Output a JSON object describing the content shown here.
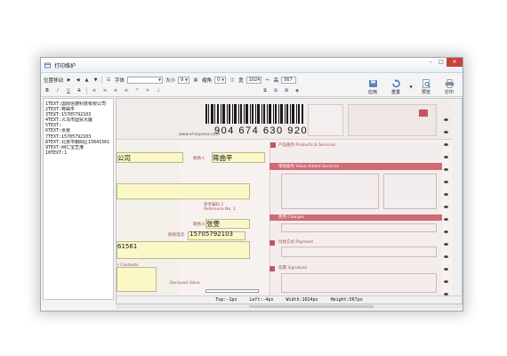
{
  "window": {
    "title": "打印维护"
  },
  "toolbar": {
    "position_label": "位置移动",
    "nav_arrows": [
      "▶",
      "◀",
      "▲",
      "▼"
    ],
    "font_label": "字体",
    "font_value": "",
    "size_label": "大小",
    "size_value": "9",
    "spacing_label": "缩角",
    "spacing_value": "0",
    "width_label": "宽",
    "width_value": "1024",
    "height_label": "高",
    "height_value": "567",
    "format_buttons": [
      "B",
      "I",
      "U",
      "S"
    ],
    "actions": [
      {
        "label": "应用",
        "icon": "apply-icon"
      },
      {
        "label": "重置",
        "icon": "reset-icon"
      },
      {
        "label": "预览",
        "icon": "preview-icon"
      },
      {
        "label": "打印",
        "icon": "print-icon"
      }
    ]
  },
  "fields": [
    "1TEXT:国际信德科技有限公司",
    "2TEXT:蒋曲平",
    "3TEXT:15705792103",
    "4TEXT:义乌市国贸大厦",
    "5TEXT:",
    "6TEXT:张雯",
    "7TEXT:15705792103",
    "8TEXT:北京市朝阳区15641561",
    "9TEXT:网仁宝芝港",
    "10TEXT:1"
  ],
  "waybill": {
    "barcode_number": "904 674 630 920",
    "website": "www.sf-express.com",
    "products_services": "产品服务 Products & Services",
    "value_added": "增值服务 Value Added Services",
    "charges": "费用 Charges",
    "payment": "付款方式 Payment",
    "signature": "签署 Signature",
    "contents": "t Contents",
    "declared_value": "Declared Value",
    "ref_label": "参考编码 2",
    "ref_label_en": "Reference No. 2"
  },
  "overlay": {
    "sender_company": "公司",
    "sender_name": "蒋曲平",
    "receiver_name": "张雯",
    "receiver_phone": "15705792103",
    "postal_code": "61561",
    "contact_label": "联络人",
    "contact_label2": "联络人",
    "phone_label": "联络电话"
  },
  "status": {
    "top": "Top:-1px",
    "left": "Left:-4px",
    "width": "Width:1024px",
    "height": "Height:567px"
  }
}
